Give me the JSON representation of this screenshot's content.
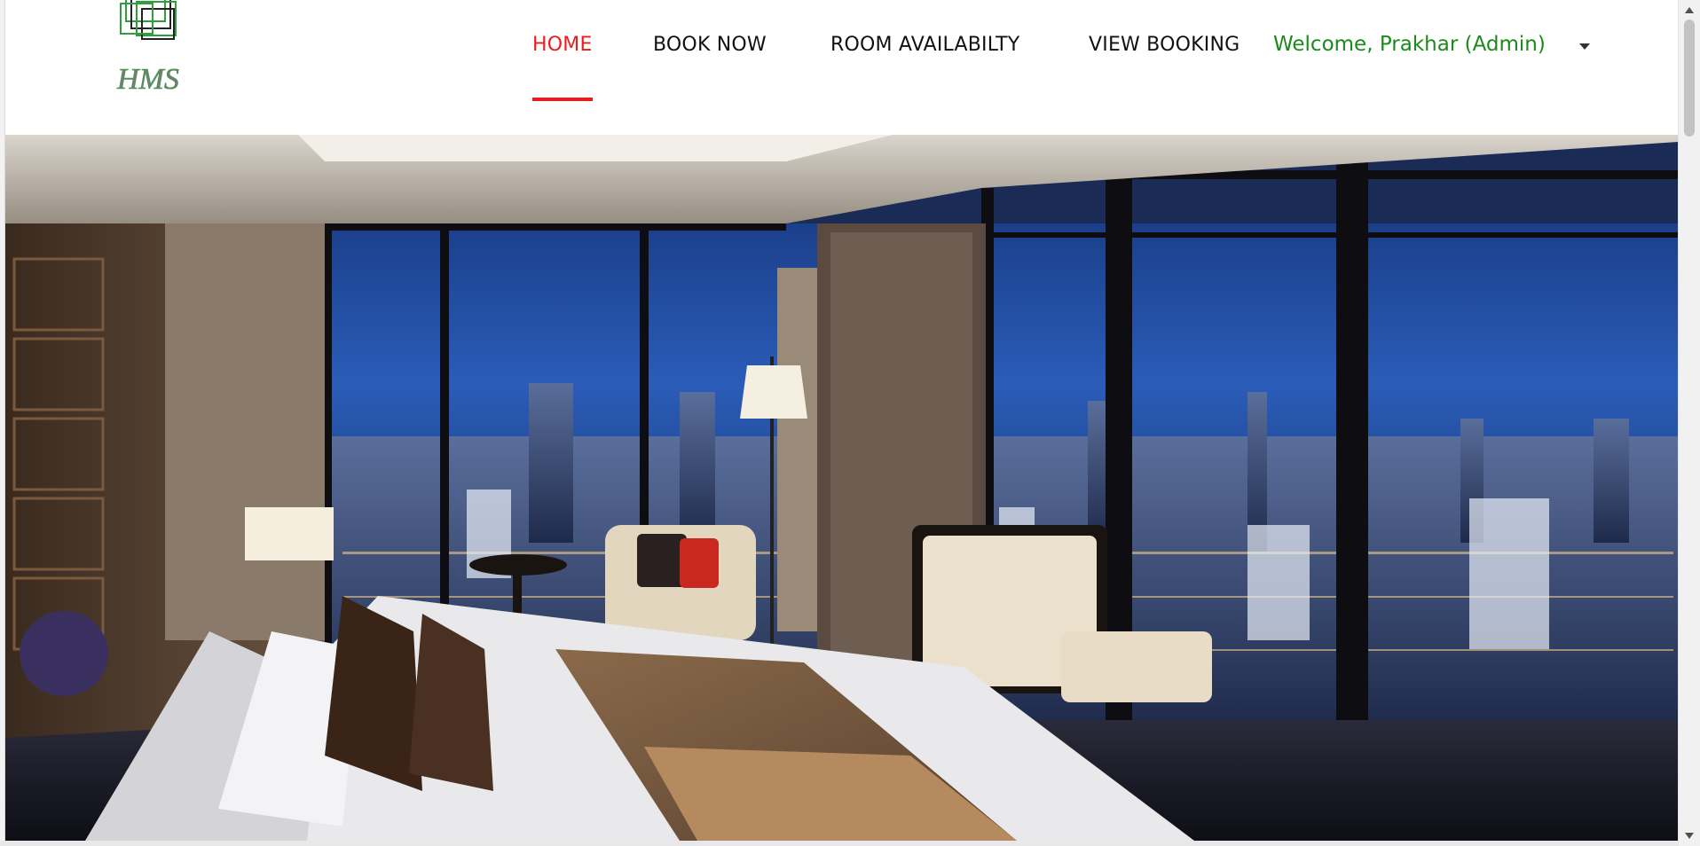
{
  "brand": {
    "logo_text": "HMS",
    "logo_icon": "stacked-squares-logo-icon",
    "accent_color": "#2e9e3e"
  },
  "nav": {
    "items": [
      {
        "label": "HOME",
        "active": true
      },
      {
        "label": "BOOK NOW",
        "active": false
      },
      {
        "label": "ROOM AVAILABILTY",
        "active": false
      },
      {
        "label": "VIEW BOOKING",
        "active": false
      }
    ],
    "active_color": "#ec1c1c",
    "user_menu": {
      "label": "Welcome, Prakhar (Admin)",
      "color": "#1a8a1a",
      "icon": "caret-down-icon"
    }
  },
  "hero": {
    "image": "hotel-room-city-view-image"
  }
}
